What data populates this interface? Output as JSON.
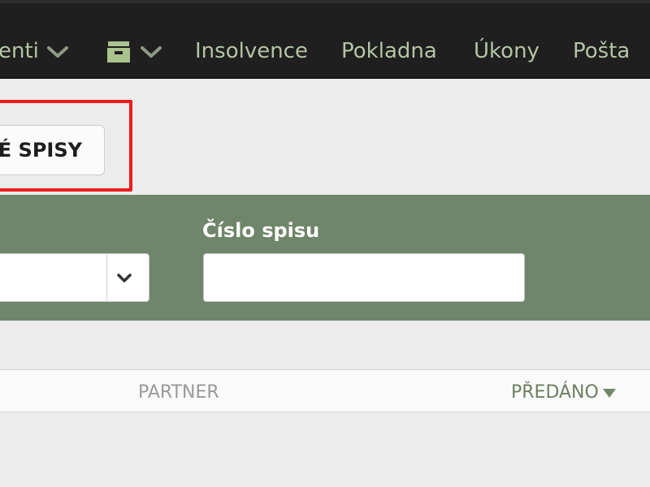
{
  "nav": {
    "items": [
      {
        "label": "enti"
      },
      {
        "label": "Insolvence"
      },
      {
        "label": "Pokladna"
      },
      {
        "label": "Úkony"
      },
      {
        "label": "Pošta"
      }
    ],
    "icons": [
      "chevron-down-icon",
      "archive-box-icon"
    ]
  },
  "toolbar": {
    "button_label": "É SPISY"
  },
  "filter": {
    "case_number_label": "Číslo spisu",
    "case_number_value": "",
    "select_value": ""
  },
  "table": {
    "columns": [
      {
        "label": "PARTNER"
      },
      {
        "label": "PŘEDÁNO",
        "sorted": "desc"
      }
    ]
  },
  "colors": {
    "nav_bg": "#1f1f1f",
    "nav_text": "#b4c4a6",
    "panel_green": "#6f866a",
    "highlight_red": "#ee1c1c"
  }
}
